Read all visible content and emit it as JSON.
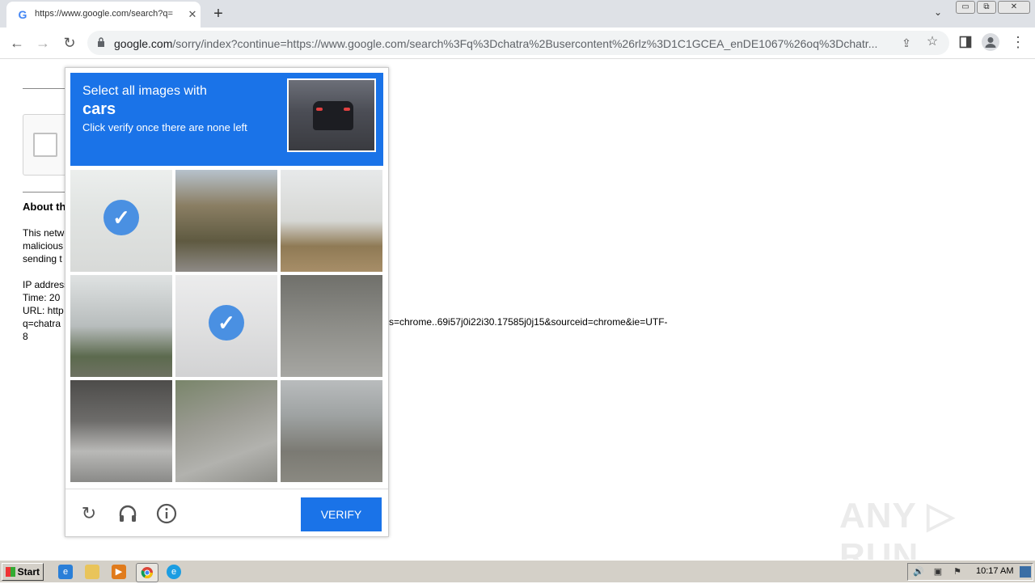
{
  "browser": {
    "tab_title": "https://www.google.com/search?q=",
    "tab_favicon": "G",
    "url_host": "google.com",
    "url_path": "/sorry/index?continue=https://www.google.com/search%3Fq%3Dchatra%2Busercontent%26rlz%3D1C1GCEA_enDE1067%26oq%3Dchatr...",
    "icons": {
      "back": "←",
      "forward": "→",
      "reload": "↻",
      "new_tab": "+",
      "close_tab": "✕",
      "tab_search": "⌄",
      "share": "⇪",
      "bookmark": "☆",
      "menu": "⋮"
    },
    "window_buttons": [
      "▭",
      "⧉",
      "✕"
    ]
  },
  "page": {
    "about_heading": "About this page",
    "para1": [
      "This network",
      "malicious",
      "sending t"
    ],
    "ip_label": "IP address",
    "time_label": "Time: 20",
    "url_label": "URL: http",
    "q_label": "q=chatra",
    "url_tail": "s=chrome..69i57j0i22i30.17585j0j15&sourceid=chrome&ie=UTF-",
    "url_tail2": "8"
  },
  "captcha": {
    "instruction_line1": "Select all images with",
    "target": "cars",
    "instruction_line3": "Click verify once there are none left",
    "tiles": [
      {
        "selected": true
      },
      {
        "selected": false
      },
      {
        "selected": false
      },
      {
        "selected": false
      },
      {
        "selected": true
      },
      {
        "selected": false
      },
      {
        "selected": false
      },
      {
        "selected": false
      },
      {
        "selected": false
      }
    ],
    "check_glyph": "✓",
    "verify_label": "VERIFY",
    "reload_glyph": "↻",
    "audio_glyph": "🎧",
    "info_glyph": "ⓘ",
    "colors": {
      "accent": "#1a73e8",
      "check": "#4a90e2"
    }
  },
  "watermark": "ANY ▷ RUN",
  "taskbar": {
    "start_label": "Start",
    "clock": "10:17 AM"
  }
}
